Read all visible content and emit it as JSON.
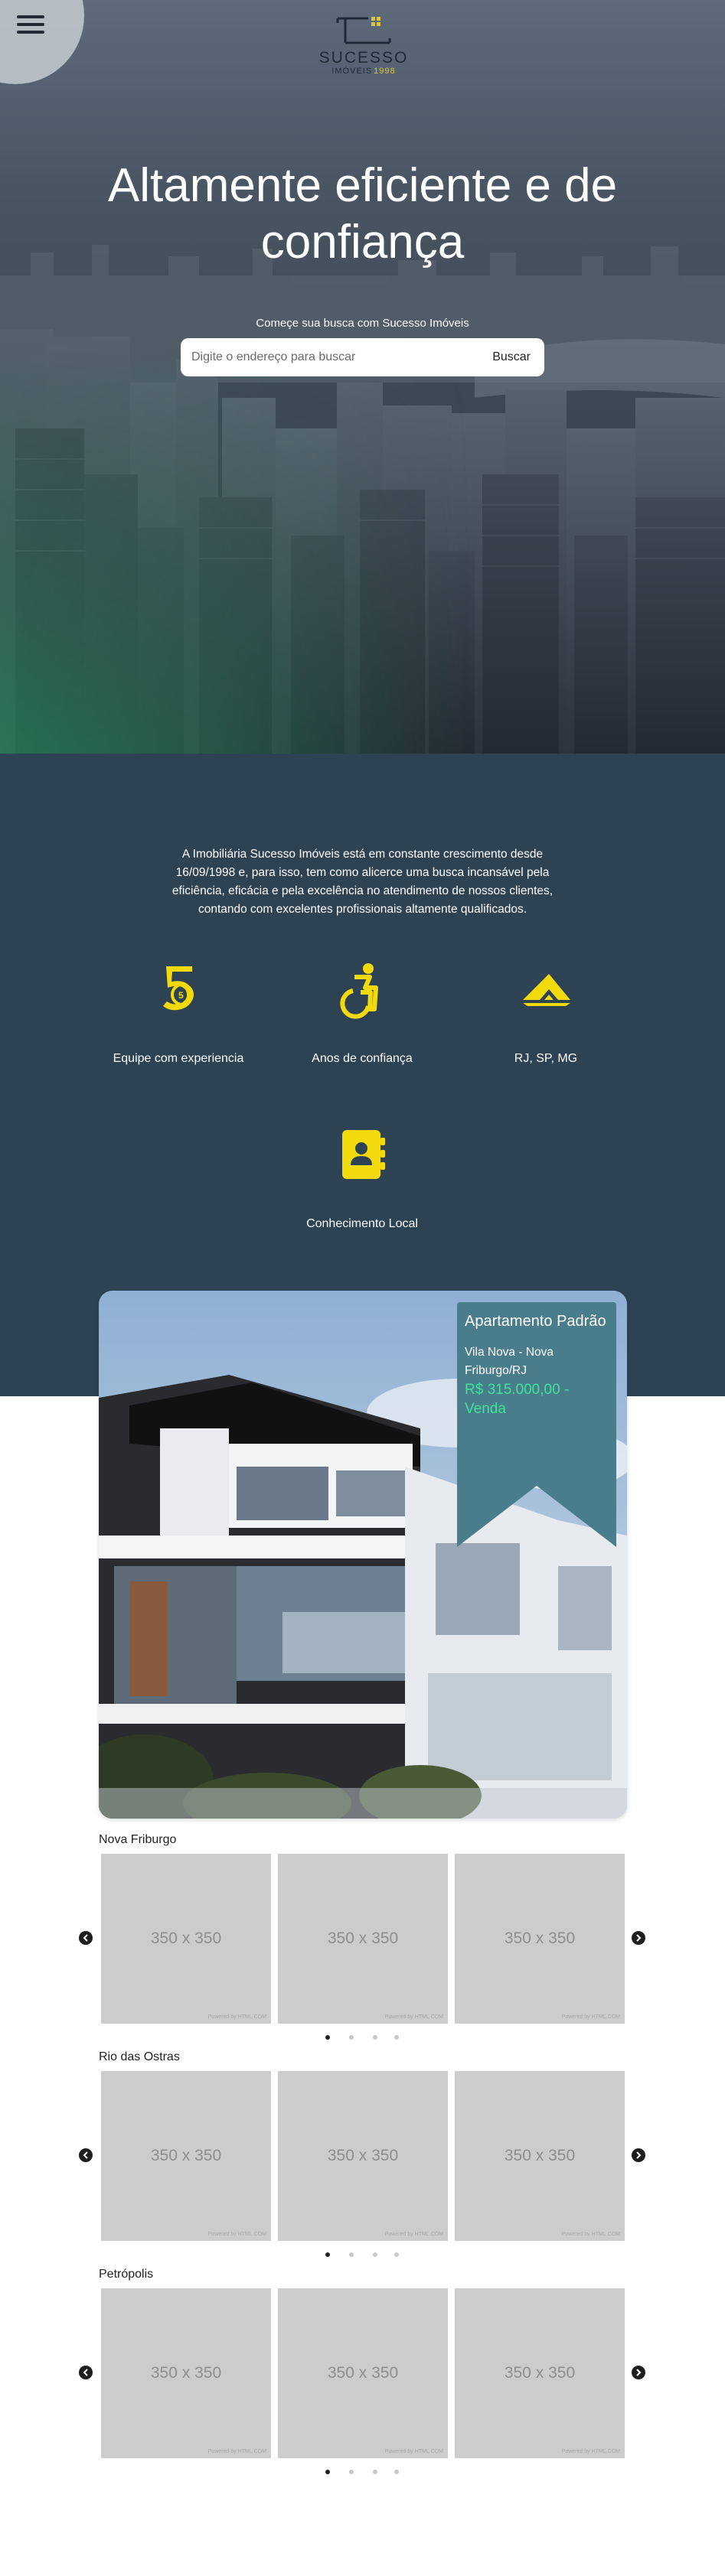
{
  "header": {
    "menu_icon": "hamburger-icon",
    "logo": {
      "brand": "SUCESSO",
      "sub": "IMÓVEIS",
      "year": "1998",
      "icon": "house-roof-logo-icon"
    }
  },
  "hero": {
    "title": "Altamente eficiente e de confiança",
    "subtitle": "Começe sua busca com Sucesso Imóveis",
    "search": {
      "placeholder": "Digite o endereço para buscar",
      "button_label": "Buscar"
    },
    "accent_color": "#2baa6e"
  },
  "about": {
    "text": "A Imobiliária Sucesso Imóveis está em constante crescimento desde 16/09/1998 e, para isso, tem como alicerce uma busca incansável pela eficiência, eficácia e pela excelência no atendimento de nossos clientes, contando com excelentes profissionais altamente qualificados.",
    "background": "#2d4354",
    "icon_color": "#f2da0c",
    "features": [
      {
        "label": "Equipe com experiencia",
        "icon": "five-years-icon"
      },
      {
        "label": "Anos de confiança",
        "icon": "accessible-icon"
      },
      {
        "label": "RJ, SP, MG",
        "icon": "map-region-icon"
      },
      {
        "label": "Conhecimento Local",
        "icon": "address-book-icon"
      }
    ]
  },
  "featured": {
    "title": "Apartamento Padrão",
    "address": "Vila Nova - Nova Friburgo/RJ",
    "price": "R$ 315.000,00 - Venda",
    "ribbon_color": "#4a7d8c",
    "price_color": "#3fe39a"
  },
  "carousels": [
    {
      "city": "Nova Friburgo",
      "slides": [
        {
          "placeholder": "350 x 350",
          "credit": "Powered by HTML.COM"
        },
        {
          "placeholder": "350 x 350",
          "credit": "Powered by HTML.COM"
        },
        {
          "placeholder": "350 x 350",
          "credit": "Powered by HTML.COM"
        }
      ],
      "dots": 4,
      "active_dot": 1
    },
    {
      "city": "Rio das Ostras",
      "slides": [
        {
          "placeholder": "350 x 350",
          "credit": "Powered by HTML.COM"
        },
        {
          "placeholder": "350 x 350",
          "credit": "Powered by HTML.COM"
        },
        {
          "placeholder": "350 x 350",
          "credit": "Powered by HTML.COM"
        }
      ],
      "dots": 4,
      "active_dot": 1
    },
    {
      "city": "Petrópolis",
      "slides": [
        {
          "placeholder": "350 x 350",
          "credit": "Powered by HTML.COM"
        },
        {
          "placeholder": "350 x 350",
          "credit": "Powered by HTML.COM"
        },
        {
          "placeholder": "350 x 350",
          "credit": "Powered by HTML.COM"
        }
      ],
      "dots": 4,
      "active_dot": 1
    }
  ]
}
